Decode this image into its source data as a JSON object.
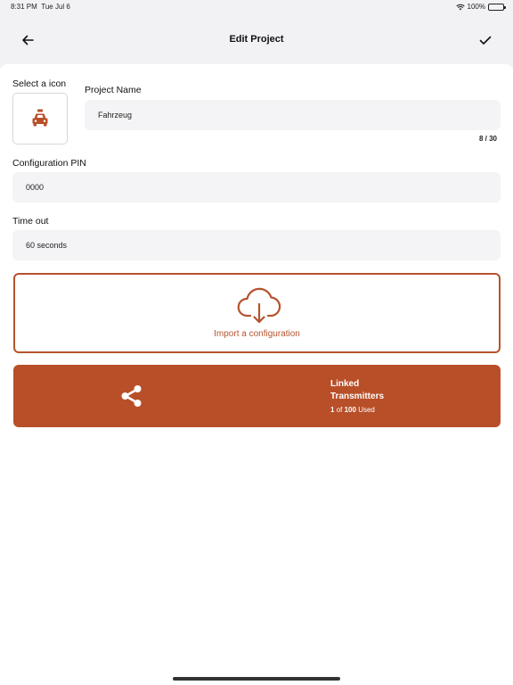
{
  "status_bar": {
    "time": "8:31 PM",
    "date": "Tue Jul 6",
    "battery": "100%"
  },
  "nav": {
    "title": "Edit Project",
    "back_icon": "arrow-left-icon",
    "done_icon": "checkmark-icon"
  },
  "icon_section": {
    "label": "Select a icon",
    "selected_icon": "taxi-car-icon"
  },
  "project_name": {
    "label": "Project Name",
    "value": "Fahrzeug",
    "counter": "8 / 30"
  },
  "config_pin": {
    "label": "Configuration PIN",
    "value": "0000"
  },
  "timeout": {
    "label": "Time out",
    "value": "60 seconds"
  },
  "import": {
    "label": "Import a configuration",
    "icon": "cloud-download-icon"
  },
  "linked": {
    "title_line1": "Linked",
    "title_line2": "Transmitters",
    "used_count": "1",
    "of_text": "of",
    "total": "100",
    "used_text": "Used",
    "icon": "share-icon"
  },
  "colors": {
    "accent": "#b84f29",
    "background_top": "#f2f2f4",
    "field_background": "#f4f4f6"
  }
}
